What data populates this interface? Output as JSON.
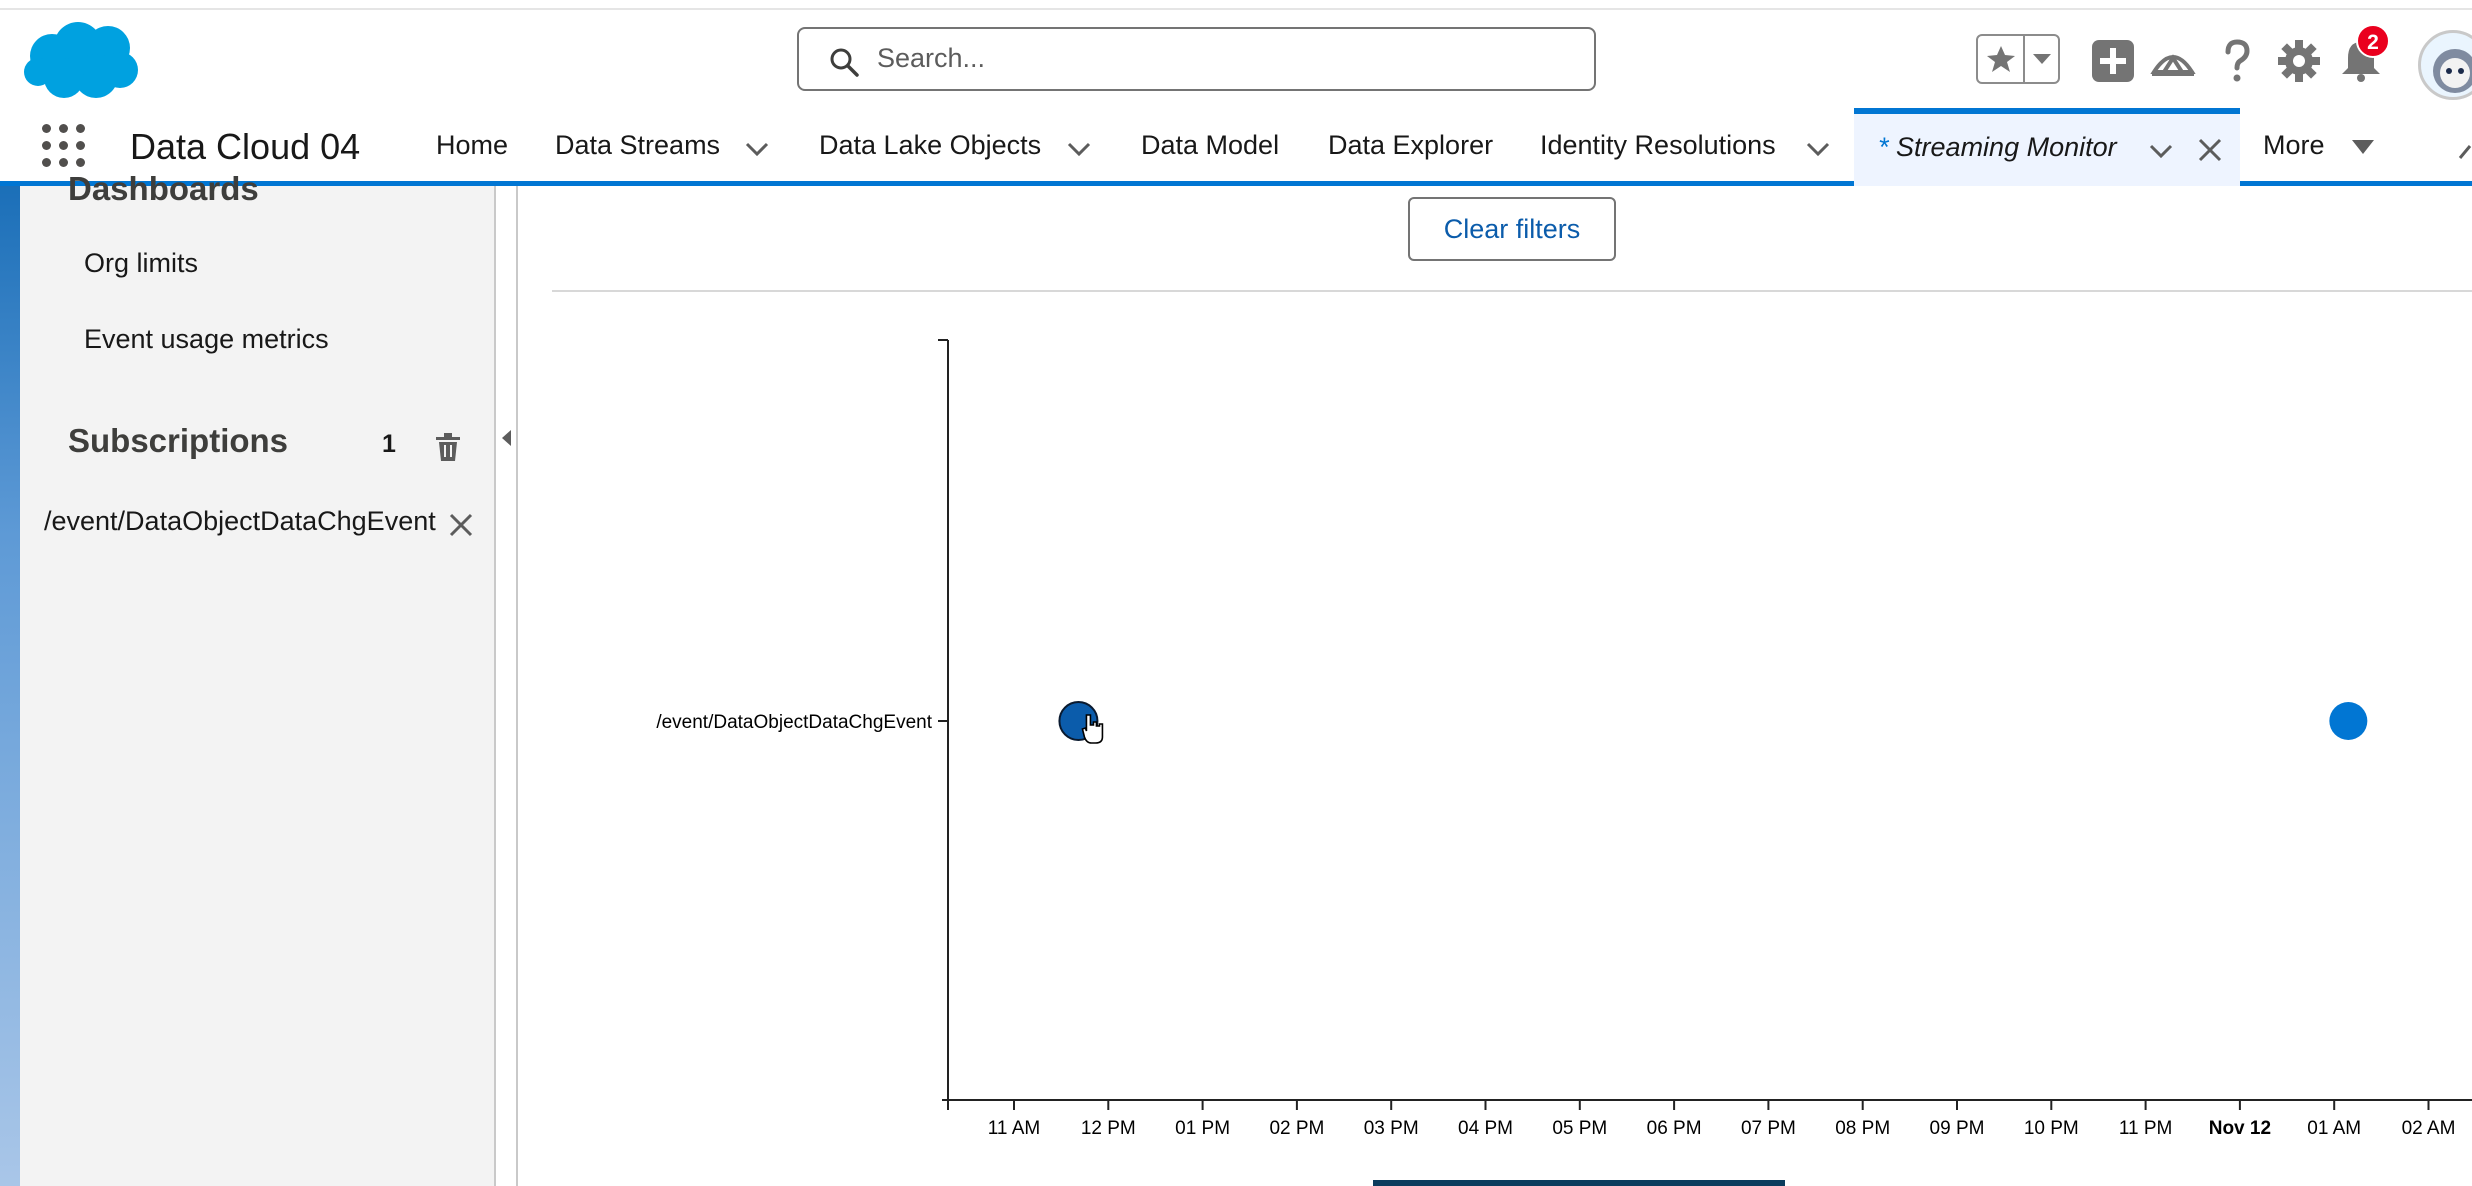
{
  "header": {
    "search_placeholder": "Search...",
    "notifications_count": "2",
    "icons": [
      "salesforce-cloud-logo",
      "search-icon",
      "star-icon",
      "caret-down-icon",
      "plus-icon",
      "trailhead-icon",
      "help-icon",
      "gear-icon",
      "bell-icon",
      "avatar"
    ]
  },
  "nav": {
    "app_name": "Data Cloud 04",
    "items": [
      {
        "label": "Home",
        "has_menu": false
      },
      {
        "label": "Data Streams",
        "has_menu": true
      },
      {
        "label": "Data Lake Objects",
        "has_menu": true
      },
      {
        "label": "Data Model",
        "has_menu": false
      },
      {
        "label": "Data Explorer",
        "has_menu": false
      },
      {
        "label": "Identity Resolutions",
        "has_menu": true
      }
    ],
    "active_tab": {
      "prefix": "*",
      "label": "Streaming Monitor"
    },
    "more_label": "More"
  },
  "sidebar": {
    "section_heading": "Dashboards",
    "links": [
      "Org limits",
      "Event usage metrics"
    ],
    "subscriptions_title": "Subscriptions",
    "subscriptions_count": "1",
    "subscriptions": [
      "/event/DataObjectDataChgEvent"
    ]
  },
  "main": {
    "clear_filters_label": "Clear filters"
  },
  "chart_data": {
    "type": "scatter",
    "categories": [
      "/event/DataObjectDataChgEvent"
    ],
    "x_ticks": [
      {
        "label": "11 AM",
        "bold": false
      },
      {
        "label": "12 PM",
        "bold": false
      },
      {
        "label": "01 PM",
        "bold": false
      },
      {
        "label": "02 PM",
        "bold": false
      },
      {
        "label": "03 PM",
        "bold": false
      },
      {
        "label": "04 PM",
        "bold": false
      },
      {
        "label": "05 PM",
        "bold": false
      },
      {
        "label": "06 PM",
        "bold": false
      },
      {
        "label": "07 PM",
        "bold": false
      },
      {
        "label": "08 PM",
        "bold": false
      },
      {
        "label": "09 PM",
        "bold": false
      },
      {
        "label": "10 PM",
        "bold": false
      },
      {
        "label": "11 PM",
        "bold": false
      },
      {
        "label": "Nov 12",
        "bold": true
      },
      {
        "label": "01 AM",
        "bold": false
      },
      {
        "label": "02 AM",
        "bold": false
      }
    ],
    "points": [
      {
        "category": "/event/DataObjectDataChgEvent",
        "x": "11:41 AM",
        "highlighted": true
      },
      {
        "category": "/event/DataObjectDataChgEvent",
        "x": "01:09 AM",
        "highlighted": false
      }
    ],
    "point_color": "#0176d3",
    "highlight_color": "#0b5cab"
  }
}
